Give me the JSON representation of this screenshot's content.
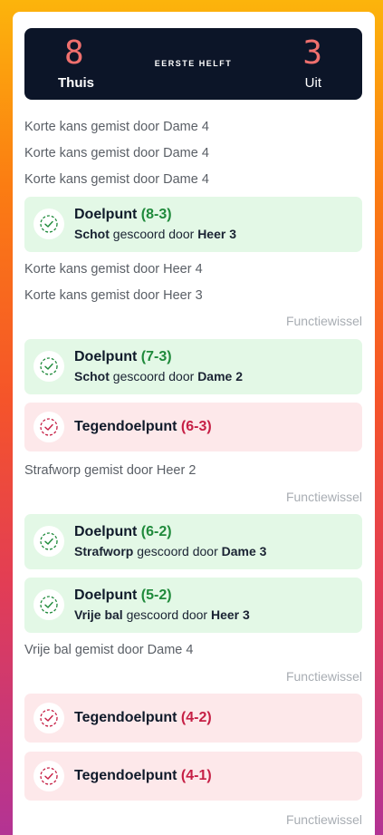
{
  "scoreboard": {
    "home_score": "8",
    "away_score": "3",
    "period": "EERSTE HELFT",
    "home_label": "Thuis",
    "away_label": "Uit"
  },
  "feed": [
    {
      "kind": "plain",
      "text": "Korte kans gemist door Dame 4"
    },
    {
      "kind": "plain",
      "text": "Korte kans gemist door Dame 4"
    },
    {
      "kind": "plain",
      "text": "Korte kans gemist door Dame 4"
    },
    {
      "kind": "goal",
      "title": "Doelpunt",
      "score": "(8-3)",
      "shot": "Schot",
      "mid": "gescoord door",
      "player": "Heer 3"
    },
    {
      "kind": "plain",
      "text": "Korte kans gemist door Heer 4"
    },
    {
      "kind": "plain",
      "text": "Korte kans gemist door Heer 3"
    },
    {
      "kind": "swap",
      "text": "Functiewissel"
    },
    {
      "kind": "goal",
      "title": "Doelpunt",
      "score": "(7-3)",
      "shot": "Schot",
      "mid": "gescoord door",
      "player": "Dame 2"
    },
    {
      "kind": "against",
      "title": "Tegendoelpunt",
      "score": "(6-3)"
    },
    {
      "kind": "plain",
      "text": "Strafworp gemist door Heer 2"
    },
    {
      "kind": "swap",
      "text": "Functiewissel"
    },
    {
      "kind": "goal",
      "title": "Doelpunt",
      "score": "(6-2)",
      "shot": "Strafworp",
      "mid": "gescoord door",
      "player": "Dame 3"
    },
    {
      "kind": "goal",
      "title": "Doelpunt",
      "score": "(5-2)",
      "shot": "Vrije bal",
      "mid": "gescoord door",
      "player": "Heer 3"
    },
    {
      "kind": "plain",
      "text": "Vrije bal gemist door Dame 4"
    },
    {
      "kind": "swap",
      "text": "Functiewissel"
    },
    {
      "kind": "against",
      "title": "Tegendoelpunt",
      "score": "(4-2)"
    },
    {
      "kind": "against",
      "title": "Tegendoelpunt",
      "score": "(4-1)"
    },
    {
      "kind": "swap",
      "text": "Functiewissel"
    }
  ],
  "colors": {
    "goal_bg": "#e3f8e6",
    "goal_accent": "#1f8a3b",
    "against_bg": "#fde8ea",
    "against_accent": "#c61f45",
    "scoreboard_bg": "#0c1528",
    "digit": "#f0706e"
  },
  "icons": {
    "goal": "check-circle-dashed-icon",
    "against": "check-circle-dashed-icon"
  }
}
